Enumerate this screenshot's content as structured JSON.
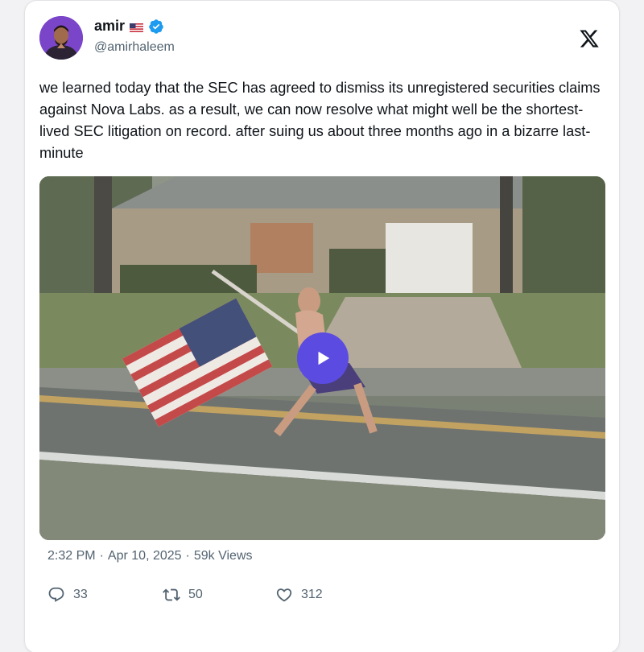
{
  "author": {
    "name": "amir",
    "flag_emoji": "🇺🇸",
    "handle": "@amirhaleem",
    "verified": true,
    "avatar_icon": "avatar-photo"
  },
  "platform_logo": "x-logo-icon",
  "tweet": {
    "text": "we learned today that the SEC has agreed to dismiss its unregistered securities claims against Nova Labs. as a result, we can now resolve what might well be the shortest-lived SEC litigation on record. after suing us about three months ago in a bizarre last-minute"
  },
  "media": {
    "type": "video",
    "play_icon": "play-icon"
  },
  "meta": {
    "time": "2:32 PM",
    "separator": "·",
    "date": "Apr 10, 2025",
    "views": "59k Views"
  },
  "actions": {
    "replies": "33",
    "reposts": "50",
    "likes": "312"
  },
  "colors": {
    "play_button": "#5b4be0",
    "verified_badge": "#1d9bf0",
    "secondary_text": "#536471"
  }
}
